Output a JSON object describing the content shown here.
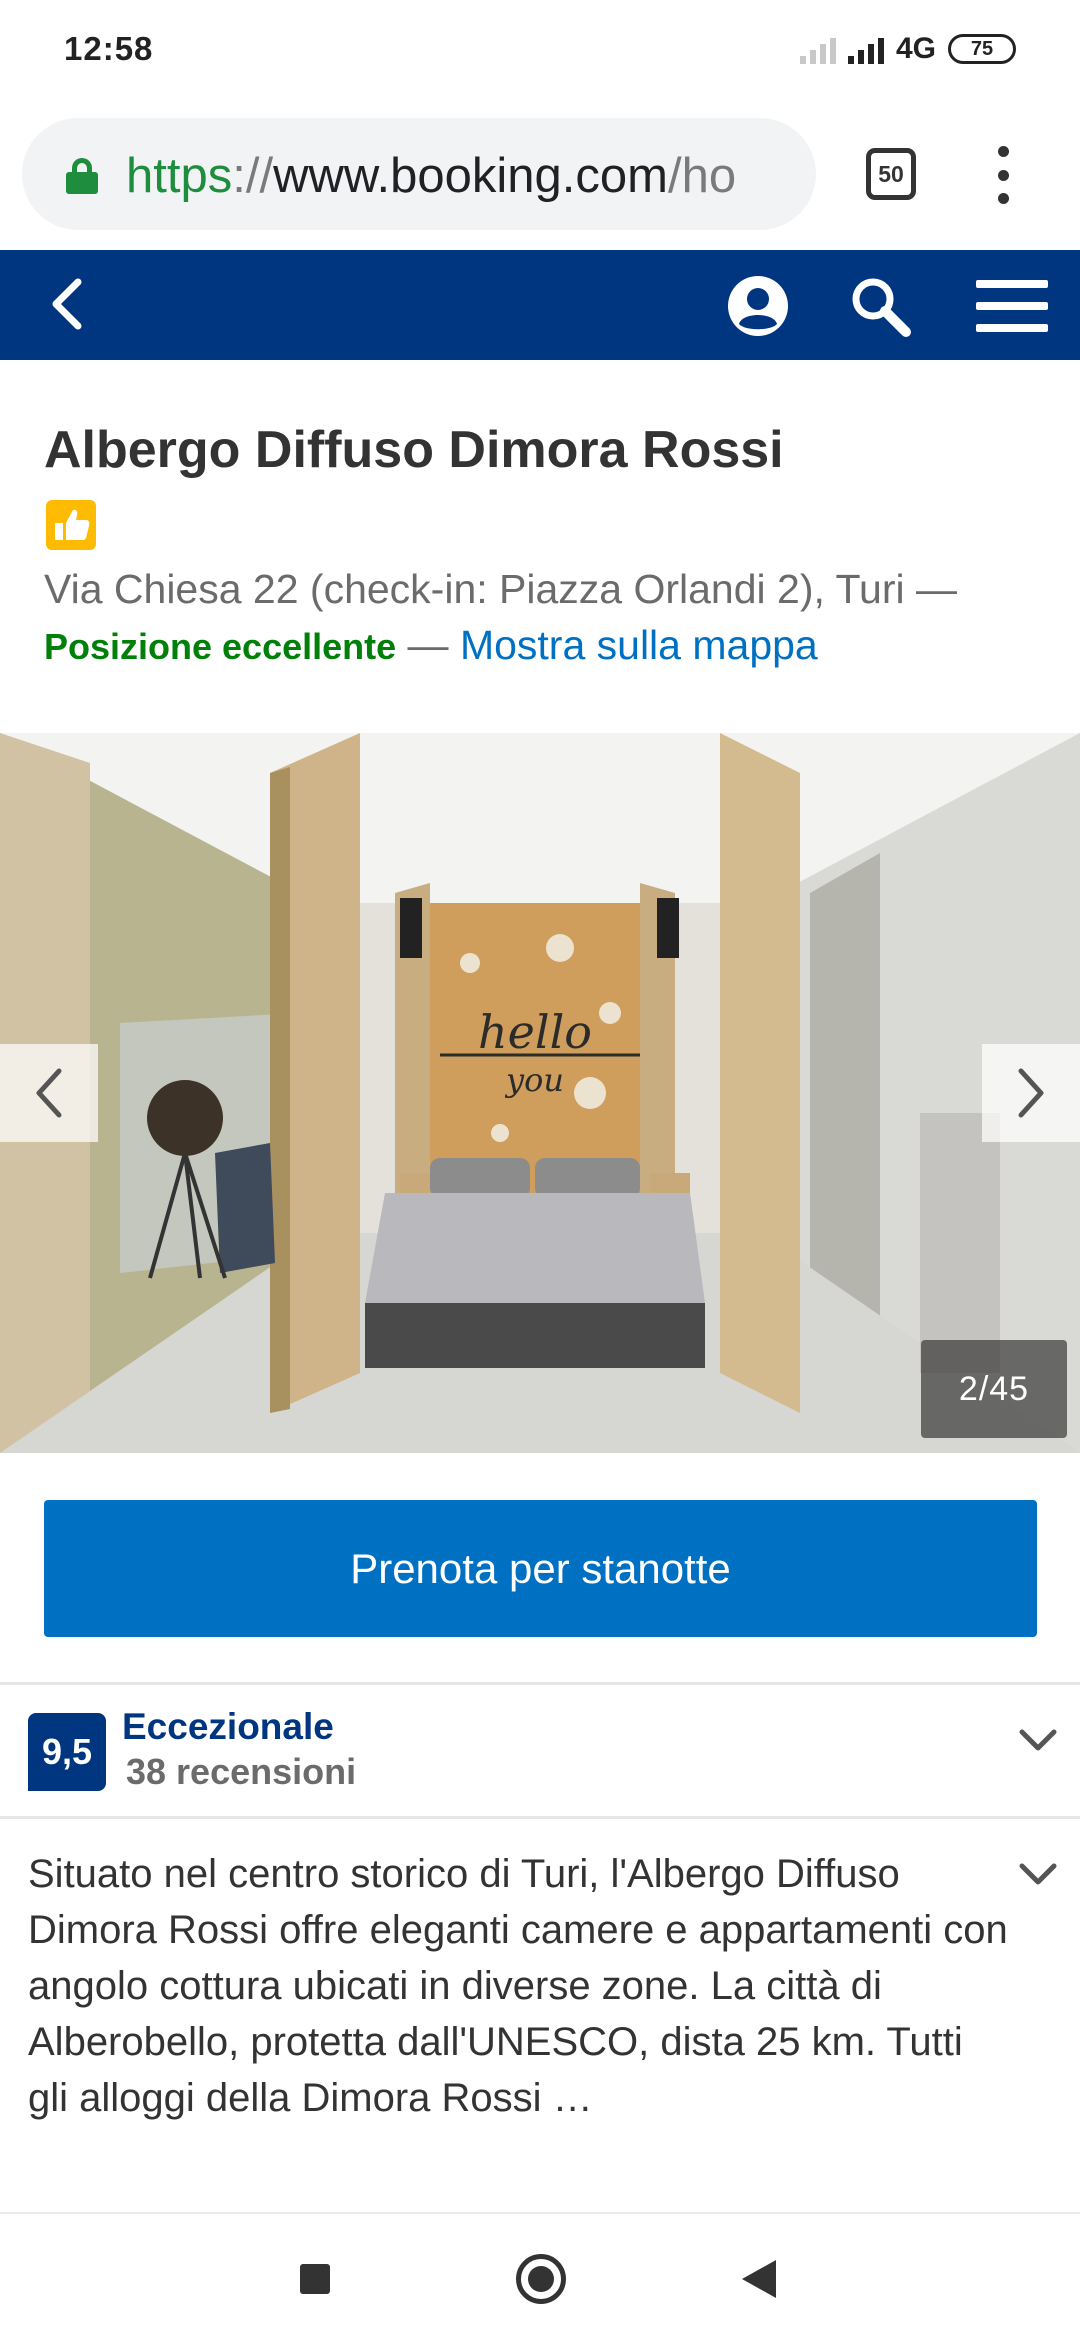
{
  "status_bar": {
    "time": "12:58",
    "network": "4G",
    "battery": "75"
  },
  "browser": {
    "url_scheme": "https",
    "url_sep": "://",
    "url_host": "www.booking.com",
    "url_rest": "/ho",
    "tab_count": "50",
    "secure_color": "#1e8e3e"
  },
  "header": {
    "background": "#003580",
    "icons": [
      "back-icon",
      "account-icon",
      "search-icon",
      "menu-icon"
    ]
  },
  "hotel": {
    "name": "Albergo Diffuso Dimora Rossi",
    "badge_icon": "thumbs-up-icon",
    "address": "Via Chiesa 22 (check-in: Piazza Orlandi 2), Turi —",
    "location_rating": "Posizione eccellente",
    "location_dash": " — ",
    "map_link": "Mostra sulla mappa"
  },
  "gallery": {
    "counter": "2/45",
    "photo_text": "hello you"
  },
  "booking": {
    "button_label": "Prenota per stanotte",
    "button_color": "#0071c2"
  },
  "review": {
    "score": "9,5",
    "label": "Eccezionale",
    "count": "38 recensioni"
  },
  "description": {
    "text": "Situato nel centro storico di Turi, l'Albergo Diffuso Dimora Rossi offre eleganti camere e appartamenti con angolo cottura ubicati in diverse zone. La città di Alberobello, protetta dall'UNESCO, dista 25 km. Tutti gli alloggi della Dimora Rossi …"
  },
  "system_nav": {
    "icons": [
      "recents-icon",
      "home-icon",
      "back-nav-icon"
    ]
  }
}
